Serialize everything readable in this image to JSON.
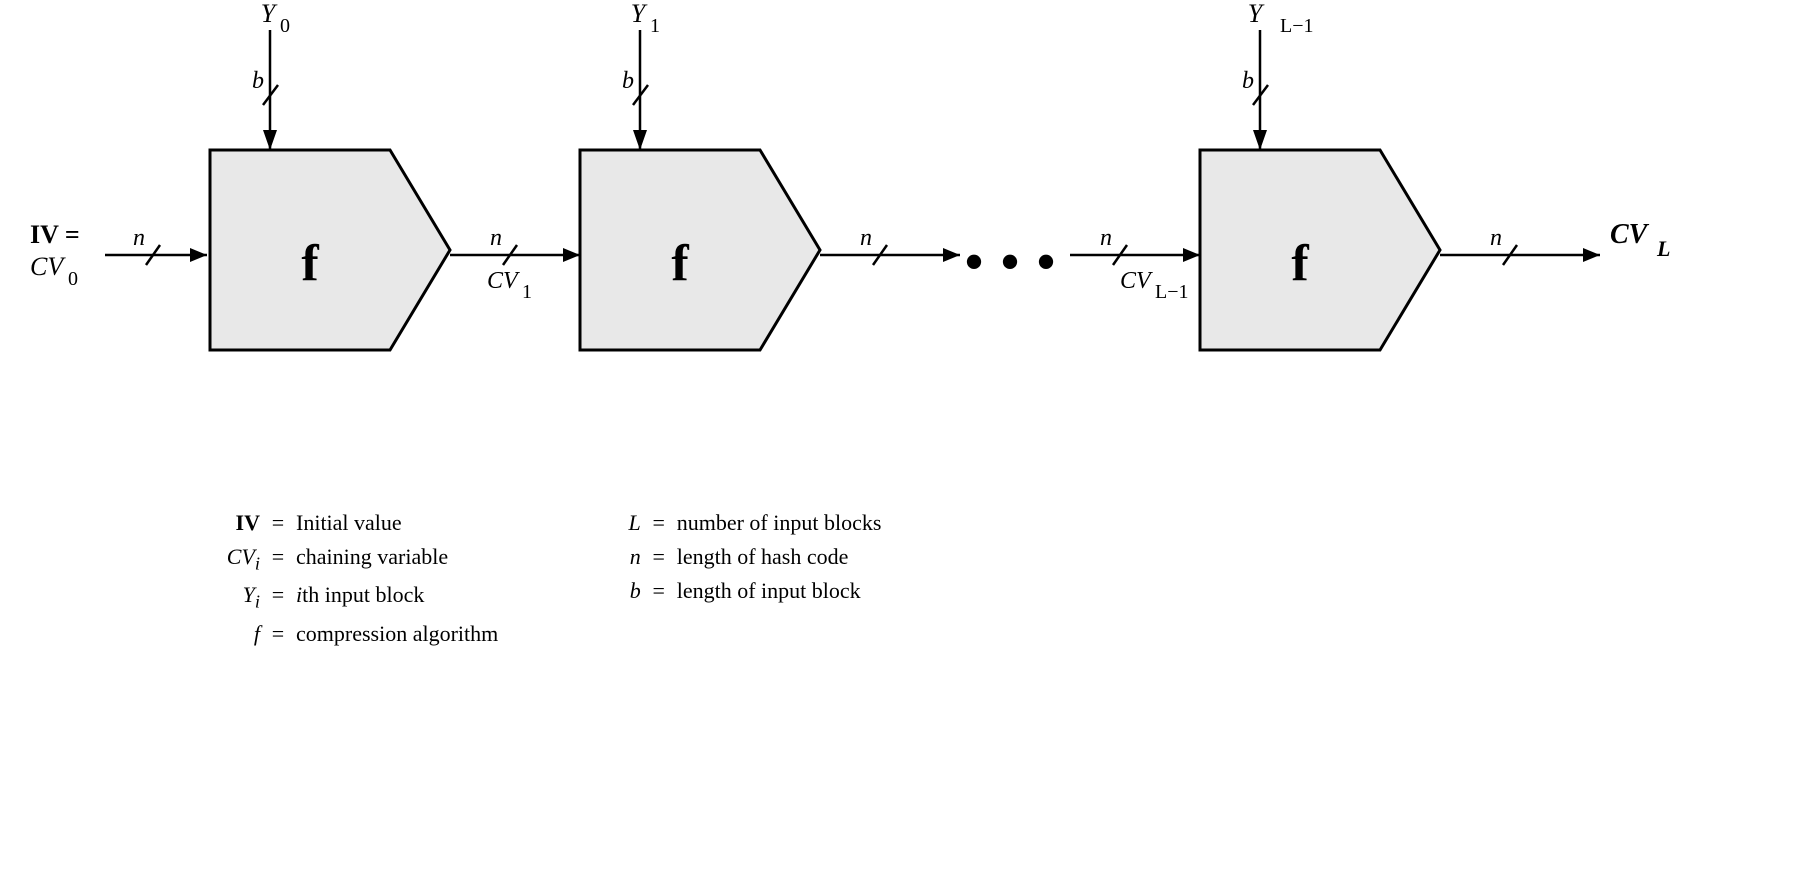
{
  "legend": {
    "left": [
      {
        "sym": "IV",
        "bold": true,
        "eq": "=",
        "desc": "Initial value"
      },
      {
        "sym": "CV<sub>i</sub>",
        "bold": false,
        "eq": "=",
        "desc": "chaining variable"
      },
      {
        "sym": "Y<sub>i</sub>",
        "bold": false,
        "eq": "=",
        "desc": "ith input block"
      },
      {
        "sym": "f",
        "bold": false,
        "eq": "=",
        "desc": "compression algorithm"
      }
    ],
    "right": [
      {
        "sym": "L",
        "bold": false,
        "eq": "=",
        "desc": "number of input blocks"
      },
      {
        "sym": "n",
        "bold": false,
        "eq": "=",
        "desc": "length of hash code"
      },
      {
        "sym": "b",
        "bold": false,
        "eq": "=",
        "desc": "length of input block"
      }
    ]
  }
}
